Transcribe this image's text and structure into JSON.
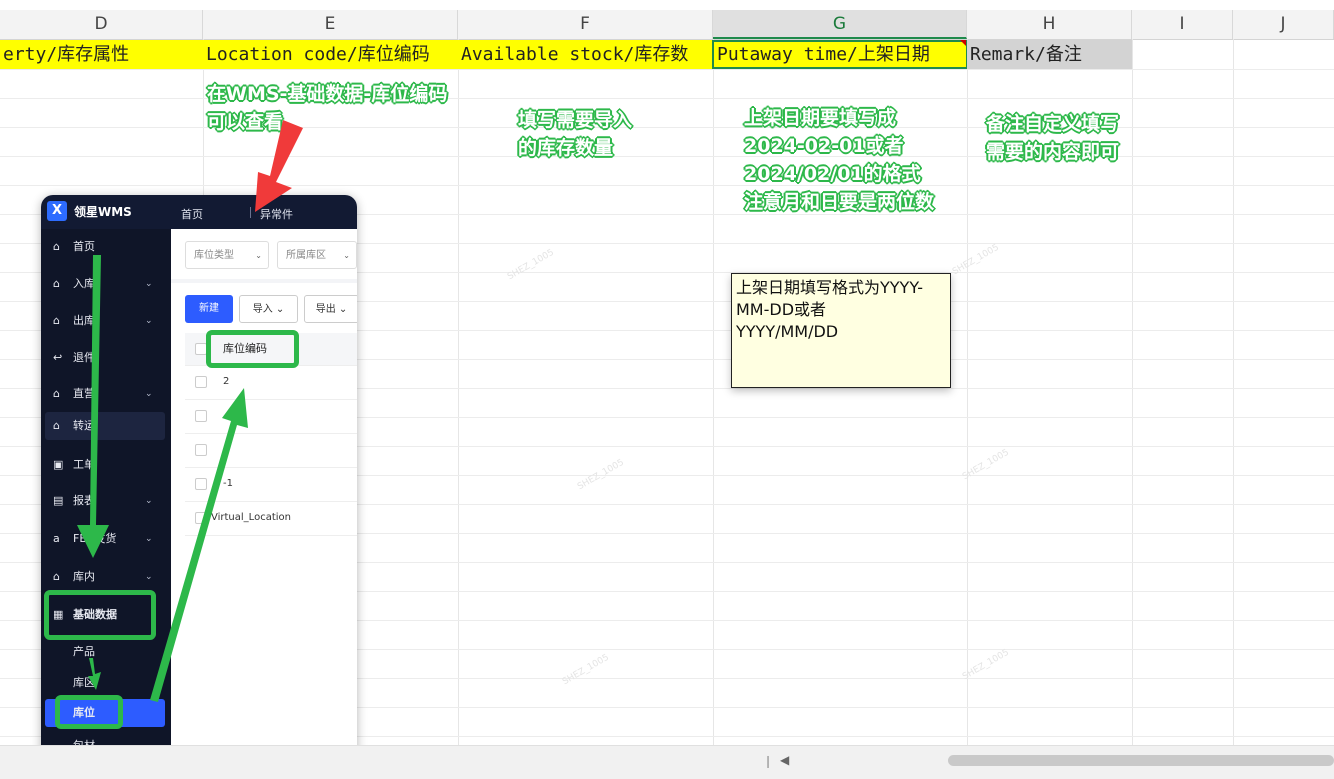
{
  "columns": [
    "D",
    "E",
    "F",
    "G",
    "H",
    "I",
    "J"
  ],
  "header_row": {
    "d": "erty/库存属性",
    "e": "Location code/库位编码",
    "f": "Available stock/库存数",
    "g": "Putaway time/上架日期",
    "h": "Remark/备注"
  },
  "notes": {
    "location": [
      "在WMS-基础数据-库位编码",
      "可以查看"
    ],
    "stock": [
      "填写需要导入",
      "的库存数量"
    ],
    "putaway": [
      "上架日期要填写成",
      "2024-02-01或者",
      "2024/02/01的格式",
      "注意月和日要是两位数"
    ],
    "remark": [
      "备注自定义填写",
      "需要的内容即可"
    ]
  },
  "comment": [
    "上架日期填写格式为YYYY-",
    "MM-DD或者",
    "YYYY/MM/DD"
  ],
  "wms": {
    "brand": "领星WMS",
    "logo_letter": "X",
    "top_tabs": [
      "首页",
      "异常件"
    ],
    "sidebar": [
      {
        "icon": "home-icon",
        "glyph": "⌂",
        "label": "首页",
        "chevron": false
      },
      {
        "icon": "inbound-icon",
        "glyph": "⌂",
        "label": "入库",
        "chevron": true
      },
      {
        "icon": "outbound-icon",
        "glyph": "⌂",
        "label": "出库",
        "chevron": true
      },
      {
        "icon": "return-icon",
        "glyph": "↩",
        "label": "退件",
        "chevron": false
      },
      {
        "icon": "direct-icon",
        "glyph": "⌂",
        "label": "直营",
        "chevron": true
      },
      {
        "icon": "transfer-icon",
        "glyph": "⌂",
        "label": "转运",
        "chevron": false
      },
      {
        "icon": "tool-icon",
        "glyph": "▣",
        "label": "工单",
        "chevron": false
      },
      {
        "icon": "report-icon",
        "glyph": "▤",
        "label": "报表",
        "chevron": true
      },
      {
        "icon": "fba-icon",
        "glyph": "a",
        "label": "FBA发货",
        "chevron": true
      },
      {
        "icon": "warehouse-icon",
        "glyph": "⌂",
        "label": "库内",
        "chevron": true
      },
      {
        "icon": "basic-data-icon",
        "glyph": "▦",
        "label": "基础数据",
        "chevron": false
      }
    ],
    "submenu": [
      "产品",
      "库区",
      "库位",
      "包材"
    ],
    "filters": [
      "库位类型",
      "所属库区"
    ],
    "buttons": [
      "新建",
      "导入",
      "导出"
    ],
    "table_header": "库位编码",
    "rows": [
      "2",
      "",
      "",
      "-1",
      "Virtual_Location"
    ]
  },
  "watermark": "SHEZ_1005",
  "colors": {
    "highlight_yellow": "#ffff00",
    "annotation_green": "#2db84a",
    "arrow_red": "#f03a3a",
    "wms_primary": "#2d5cff",
    "wms_dark": "#121a33"
  }
}
